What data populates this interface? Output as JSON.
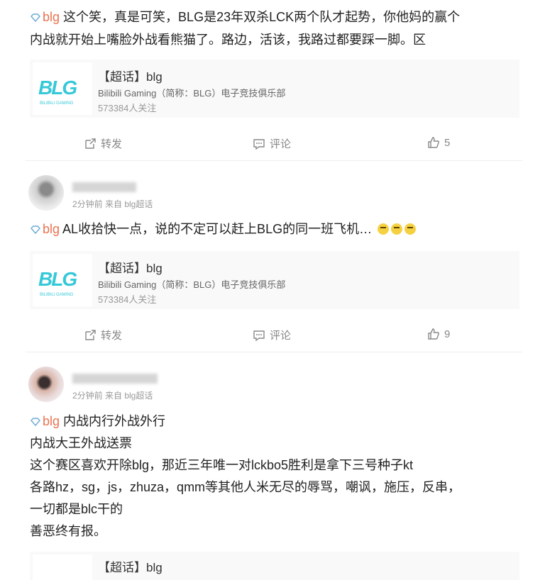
{
  "posts": [
    {
      "topic": "blg",
      "lines": [
        "这个笑，真是可笑，BLG是23年双杀LCK两个队才起势，你他妈的赢个",
        "内战就开始上嘴脸外战看熊猫了。路边，活该，我路过都要踩一脚。区"
      ],
      "card": {
        "title": "【超话】blg",
        "desc": "Bilibili Gaming（简称：BLG）电子竞技俱乐部",
        "meta": "573384人关注",
        "logo": "BLG",
        "logo_sub": "BILIBILI GAMING"
      },
      "actions": {
        "repost": "转发",
        "comment": "评论",
        "likes": "5"
      }
    },
    {
      "user_meta": "2分钟前 来自 blg超话",
      "topic": "blg",
      "lines": [
        "AL收拾快一点，说的不定可以赶上BLG的同一班飞机…"
      ],
      "card": {
        "title": "【超话】blg",
        "desc": "Bilibili Gaming（简称：BLG）电子竞技俱乐部",
        "meta": "573384人关注",
        "logo": "BLG",
        "logo_sub": "BILIBILI GAMING"
      },
      "actions": {
        "repost": "转发",
        "comment": "评论",
        "likes": "9"
      }
    },
    {
      "user_meta": "2分钟前 来自 blg超话",
      "topic": "blg",
      "lines": [
        "内战内行外战外行",
        "内战大王外战送票",
        "这个赛区喜欢开除blg，那近三年唯一对lckbo5胜利是拿下三号种子kt",
        "各路hz，sg，js，zhuza，qmm等其他人米无尽的辱骂，嘲讽，施压，反串，",
        "一切都是blc干的",
        "善恶终有报。"
      ],
      "card": {
        "title": "【超话】blg"
      }
    }
  ],
  "colors": {
    "accent": "#eb7350",
    "logo": "#36c9d8"
  }
}
